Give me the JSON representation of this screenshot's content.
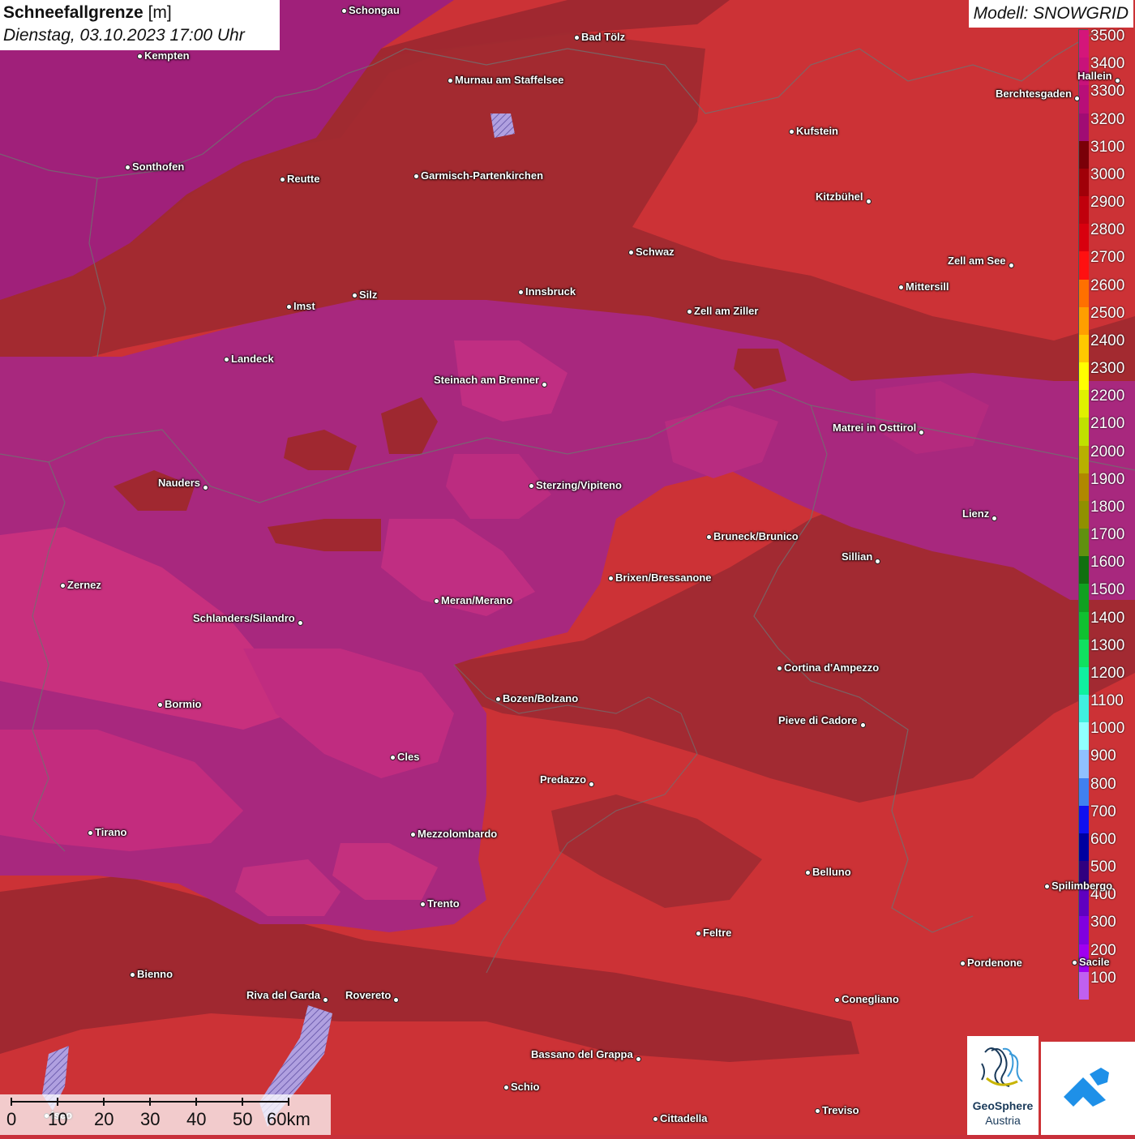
{
  "title": {
    "main": "Schneefallgrenze",
    "unit": "[m]",
    "datetime": "Dienstag, 03.10.2023 17:00 Uhr"
  },
  "model": "Modell: SNOWGRID",
  "legend": {
    "labels": [
      "3500",
      "3400",
      "3300",
      "3200",
      "3100",
      "3000",
      "2900",
      "2800",
      "2700",
      "2600",
      "2500",
      "2400",
      "2300",
      "2200",
      "2100",
      "2000",
      "1900",
      "1800",
      "1700",
      "1600",
      "1500",
      "1400",
      "1300",
      "1200",
      "1100",
      "1000",
      "900",
      "800",
      "700",
      "600",
      "500",
      "400",
      "300",
      "200",
      "100"
    ],
    "colors": [
      "#d4167a",
      "#c8127a",
      "#b80e78",
      "#a00c74",
      "#7a0008",
      "#a00008",
      "#c0000c",
      "#d8000e",
      "#ff1010",
      "#ff7000",
      "#ff9e00",
      "#ffc800",
      "#ffff00",
      "#e0f000",
      "#c0e000",
      "#b8b000",
      "#b08800",
      "#909000",
      "#609010",
      "#107010",
      "#10a020",
      "#10c030",
      "#10e060",
      "#10f0a0",
      "#40f0e0",
      "#90ffff",
      "#90c0ff",
      "#4080f0",
      "#1010f0",
      "#0000a0",
      "#300080",
      "#6000c0",
      "#8000e0",
      "#a000f0",
      "#c060f0"
    ]
  },
  "places": [
    {
      "name": "Schongau",
      "label_side": "right"
    },
    {
      "name": "Bad Tölz",
      "label_side": "right"
    },
    {
      "name": "Kempten",
      "label_side": "right"
    },
    {
      "name": "Murnau am Staffelsee",
      "label_side": "right"
    },
    {
      "name": "Hallein",
      "label_side": "left"
    },
    {
      "name": "Berchtesgaden",
      "label_side": "left"
    },
    {
      "name": "Kufstein",
      "label_side": "right"
    },
    {
      "name": "Sonthofen",
      "label_side": "right"
    },
    {
      "name": "Reutte",
      "label_side": "right"
    },
    {
      "name": "Garmisch-Partenkirchen",
      "label_side": "right"
    },
    {
      "name": "Kitzbühel",
      "label_side": "left"
    },
    {
      "name": "Schwaz",
      "label_side": "right"
    },
    {
      "name": "Zell am See",
      "label_side": "left"
    },
    {
      "name": "Mittersill",
      "label_side": "right"
    },
    {
      "name": "Innsbruck",
      "label_side": "right"
    },
    {
      "name": "Imst",
      "label_side": "right"
    },
    {
      "name": "Silz",
      "label_side": "right"
    },
    {
      "name": "Zell am Ziller",
      "label_side": "right"
    },
    {
      "name": "Landeck",
      "label_side": "right"
    },
    {
      "name": "Steinach am Brenner",
      "label_side": "left"
    },
    {
      "name": "Matrei in Osttirol",
      "label_side": "left"
    },
    {
      "name": "Nauders",
      "label_side": "left"
    },
    {
      "name": "Sterzing/Vipiteno",
      "label_side": "right"
    },
    {
      "name": "Lienz",
      "label_side": "left"
    },
    {
      "name": "Bruneck/Brunico",
      "label_side": "right"
    },
    {
      "name": "Sillian",
      "label_side": "left"
    },
    {
      "name": "Brixen/Bressanone",
      "label_side": "right"
    },
    {
      "name": "Zernez",
      "label_side": "right"
    },
    {
      "name": "Meran/Merano",
      "label_side": "right"
    },
    {
      "name": "Schlanders/Silandro",
      "label_side": "left"
    },
    {
      "name": "Cortina d'Ampezzo",
      "label_side": "right"
    },
    {
      "name": "Bozen/Bolzano",
      "label_side": "right"
    },
    {
      "name": "Bormio",
      "label_side": "right"
    },
    {
      "name": "Pieve di Cadore",
      "label_side": "left"
    },
    {
      "name": "Cles",
      "label_side": "right"
    },
    {
      "name": "Predazzo",
      "label_side": "left"
    },
    {
      "name": "Tirano",
      "label_side": "right"
    },
    {
      "name": "Mezzolombardo",
      "label_side": "right"
    },
    {
      "name": "Belluno",
      "label_side": "right"
    },
    {
      "name": "Spilimbergo",
      "label_side": "right"
    },
    {
      "name": "Trento",
      "label_side": "right"
    },
    {
      "name": "Feltre",
      "label_side": "right"
    },
    {
      "name": "Pordenone",
      "label_side": "right"
    },
    {
      "name": "Sacile",
      "label_side": "right"
    },
    {
      "name": "Bienno",
      "label_side": "right"
    },
    {
      "name": "Riva del Garda",
      "label_side": "left"
    },
    {
      "name": "Rovereto",
      "label_side": "left"
    },
    {
      "name": "Conegliano",
      "label_side": "right"
    },
    {
      "name": "Bassano del Grappa",
      "label_side": "left"
    },
    {
      "name": "Schio",
      "label_side": "right"
    },
    {
      "name": "Treviso",
      "label_side": "right"
    },
    {
      "name": "Cittadella",
      "label_side": "right"
    },
    {
      "name": "Iseo",
      "label_side": "right"
    }
  ],
  "scale": {
    "labels": [
      "0",
      "10",
      "20",
      "30",
      "40",
      "50",
      "60km"
    ]
  },
  "logos": {
    "geosphere_line1": "GeoSphere",
    "geosphere_line2": "Austria"
  }
}
